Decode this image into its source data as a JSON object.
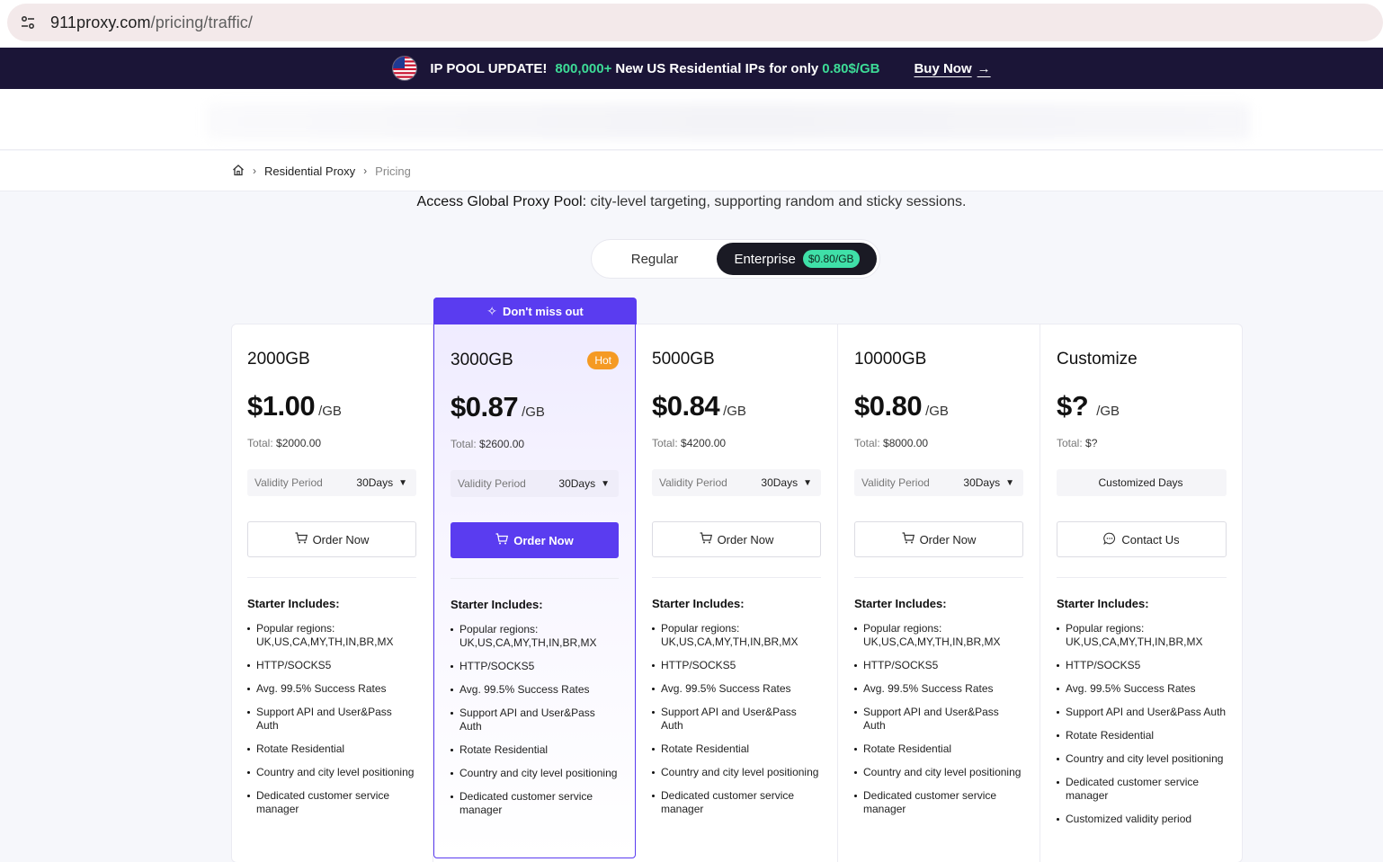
{
  "browser": {
    "url_host": "911proxy.com",
    "url_path": "/pricing/traffic/"
  },
  "promo": {
    "title": "IP POOL UPDATE!",
    "count": "800,000+",
    "text": "New US Residential IPs for only",
    "price": "0.80$/GB",
    "cta": "Buy Now",
    "arrow": "→"
  },
  "breadcrumb": {
    "home_icon": "home-icon",
    "sep": "›",
    "items": [
      "Residential Proxy",
      "Pricing"
    ]
  },
  "subtitle": {
    "lead": "Access Global Proxy Pool:",
    "rest": "city-level targeting, supporting random and sticky sessions."
  },
  "toggle": {
    "regular": "Regular",
    "enterprise": "Enterprise",
    "enterprise_badge": "$0.80/GB"
  },
  "labels": {
    "per_gb": "/GB",
    "total": "Total:",
    "validity": "Validity Period",
    "includes": "Starter Includes:",
    "hot_ribbon": "Don't miss out",
    "hot_badge": "Hot",
    "chev": "⌄"
  },
  "colors": {
    "brand": "#5a3cf0",
    "promo_bg": "#1b1537",
    "accent_green": "#3ddc97",
    "hot": "#f59a23"
  },
  "plans": [
    {
      "name": "2000GB",
      "price": "$1.00",
      "total": "$2000.00",
      "days": "30Days",
      "cta": "Order Now",
      "cta_icon": "cart-icon",
      "features": [
        "Popular regions: UK,US,CA,MY,TH,IN,BR,MX",
        "HTTP/SOCKS5",
        "Avg. 99.5% Success Rates",
        "Support API and User&Pass Auth",
        "Rotate Residential",
        "Country and city level positioning",
        "Dedicated customer service manager"
      ]
    },
    {
      "name": "3000GB",
      "price": "$0.87",
      "total": "$2600.00",
      "days": "30Days",
      "cta": "Order Now",
      "cta_icon": "cart-icon",
      "features": [
        "Popular regions: UK,US,CA,MY,TH,IN,BR,MX",
        "HTTP/SOCKS5",
        "Avg. 99.5% Success Rates",
        "Support API and User&Pass Auth",
        "Rotate Residential",
        "Country and city level positioning",
        "Dedicated customer service manager"
      ]
    },
    {
      "name": "5000GB",
      "price": "$0.84",
      "total": "$4200.00",
      "days": "30Days",
      "cta": "Order Now",
      "cta_icon": "cart-icon",
      "features": [
        "Popular regions: UK,US,CA,MY,TH,IN,BR,MX",
        "HTTP/SOCKS5",
        "Avg. 99.5% Success Rates",
        "Support API and User&Pass Auth",
        "Rotate Residential",
        "Country and city level positioning",
        "Dedicated customer service manager"
      ]
    },
    {
      "name": "10000GB",
      "price": "$0.80",
      "total": "$8000.00",
      "days": "30Days",
      "cta": "Order Now",
      "cta_icon": "cart-icon",
      "features": [
        "Popular regions: UK,US,CA,MY,TH,IN,BR,MX",
        "HTTP/SOCKS5",
        "Avg. 99.5% Success Rates",
        "Support API and User&Pass Auth",
        "Rotate Residential",
        "Country and city level positioning",
        "Dedicated customer service manager"
      ]
    },
    {
      "name": "Customize",
      "price": "$?",
      "total": "$?",
      "days_custom": "Customized Days",
      "cta": "Contact Us",
      "cta_icon": "chat-icon",
      "features": [
        "Popular regions: UK,US,CA,MY,TH,IN,BR,MX",
        "HTTP/SOCKS5",
        "Avg. 99.5% Success Rates",
        "Support API and User&Pass Auth",
        "Rotate Residential",
        "Country and city level positioning",
        "Dedicated customer service manager",
        "Customized validity period"
      ]
    }
  ]
}
